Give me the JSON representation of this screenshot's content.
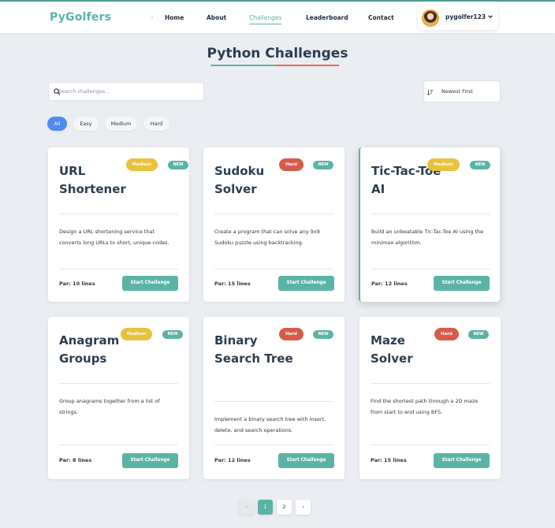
{
  "header": {
    "logo": "PyGolfers",
    "nav": [
      "Home",
      "About",
      "Challenges",
      "Leaderboard",
      "Contact"
    ],
    "active_nav": "Challenges",
    "username": "pygolfer123"
  },
  "page_title": "Python Challenges",
  "search": {
    "placeholder": "Search challenges..."
  },
  "sort": {
    "label": "Newest First"
  },
  "filters": [
    "All",
    "Easy",
    "Medium",
    "Hard"
  ],
  "cards": [
    {
      "title": "URL Shortener",
      "difficulty": "Medium",
      "badge_new": "NEW",
      "desc": "Design a URL shortening service that converts long URLs to short, unique codes.",
      "par": "Par: 10 lines",
      "button": "Start Challenge"
    },
    {
      "title": "Sudoku Solver",
      "difficulty": "Hard",
      "badge_new": "NEW",
      "desc": "Create a program that can solve any 9x9 Sudoku puzzle using backtracking.",
      "par": "Par: 15 lines",
      "button": "Start Challenge"
    },
    {
      "title": "Tic-Tac-Toe AI",
      "difficulty": "Medium",
      "badge_new": "NEW",
      "desc": "Build an unbeatable Tic-Tac-Toe AI using the minimax algorithm.",
      "par": "Par: 12 lines",
      "button": "Start Challenge"
    },
    {
      "title": "Anagram Groups",
      "difficulty": "Medium",
      "badge_new": "NEW",
      "desc": "Group anagrams together from a list of strings.",
      "par": "Par: 8 lines",
      "button": "Start Challenge"
    },
    {
      "title": "Binary Search Tree",
      "difficulty": "Hard",
      "badge_new": "NEW",
      "desc": "Implement a binary search tree with insert, delete, and search operations.",
      "par": "Par: 12 lines",
      "button": "Start Challenge"
    },
    {
      "title": "Maze Solver",
      "difficulty": "Hard",
      "badge_new": "NEW",
      "desc": "Find the shortest path through a 2D maze from start to end using BFS.",
      "par": "Par: 15 lines",
      "button": "Start Challenge"
    }
  ],
  "pagination": {
    "prev": "‹",
    "pages": [
      "1",
      "2"
    ],
    "current": "1",
    "next": "›"
  }
}
